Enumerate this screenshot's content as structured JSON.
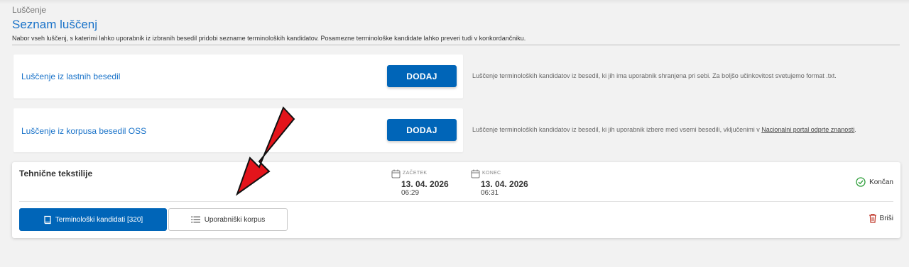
{
  "breadcrumb": "Luščenje",
  "page_title": "Seznam luščenj",
  "page_description": "Nabor vseh luščenj, s katerimi lahko uporabnik iz izbranih besedil pridobi sezname terminoloških kandidatov. Posamezne terminološke kandidate lahko preveri tudi v konkordančniku.",
  "sources": [
    {
      "label": "Luščenje iz lastnih besedil",
      "button": "DODAJ",
      "note": "Luščenje terminoloških kandidatov iz besedil, ki jih ima uporabnik shranjena pri sebi. Za boljšo učinkovitost svetujemo format .txt."
    },
    {
      "label": "Luščenje iz korpusa besedil OSS",
      "button": "DODAJ",
      "note_prefix": "Luščenje terminoloških kandidatov iz besedil, ki jih uporabnik izbere med vsemi besedili, vključenimi v ",
      "note_link": "Nacionalni portal odprte znanosti",
      "note_suffix": "."
    }
  ],
  "job": {
    "name": "Tehnične tekstilije",
    "start": {
      "caption": "ZAČETEK",
      "date": "13. 04. 2026",
      "time": "06:29"
    },
    "end": {
      "caption": "KONEC",
      "date": "13. 04. 2026",
      "time": "06:31"
    },
    "status": "Končan",
    "status_color": "#2e9e3a",
    "terms_button": "Terminološki kandidati [320]",
    "corpus_button": "Uporabniški korpus",
    "delete_label": "Briši",
    "delete_color": "#c0392b"
  },
  "accent_color": "#0065b8",
  "annotation_arrow_color": "#e3141b",
  "icons": [
    "calendar-icon",
    "check-circle-icon",
    "book-icon",
    "list-icon",
    "trash-icon",
    "red-arrow-annotation"
  ]
}
